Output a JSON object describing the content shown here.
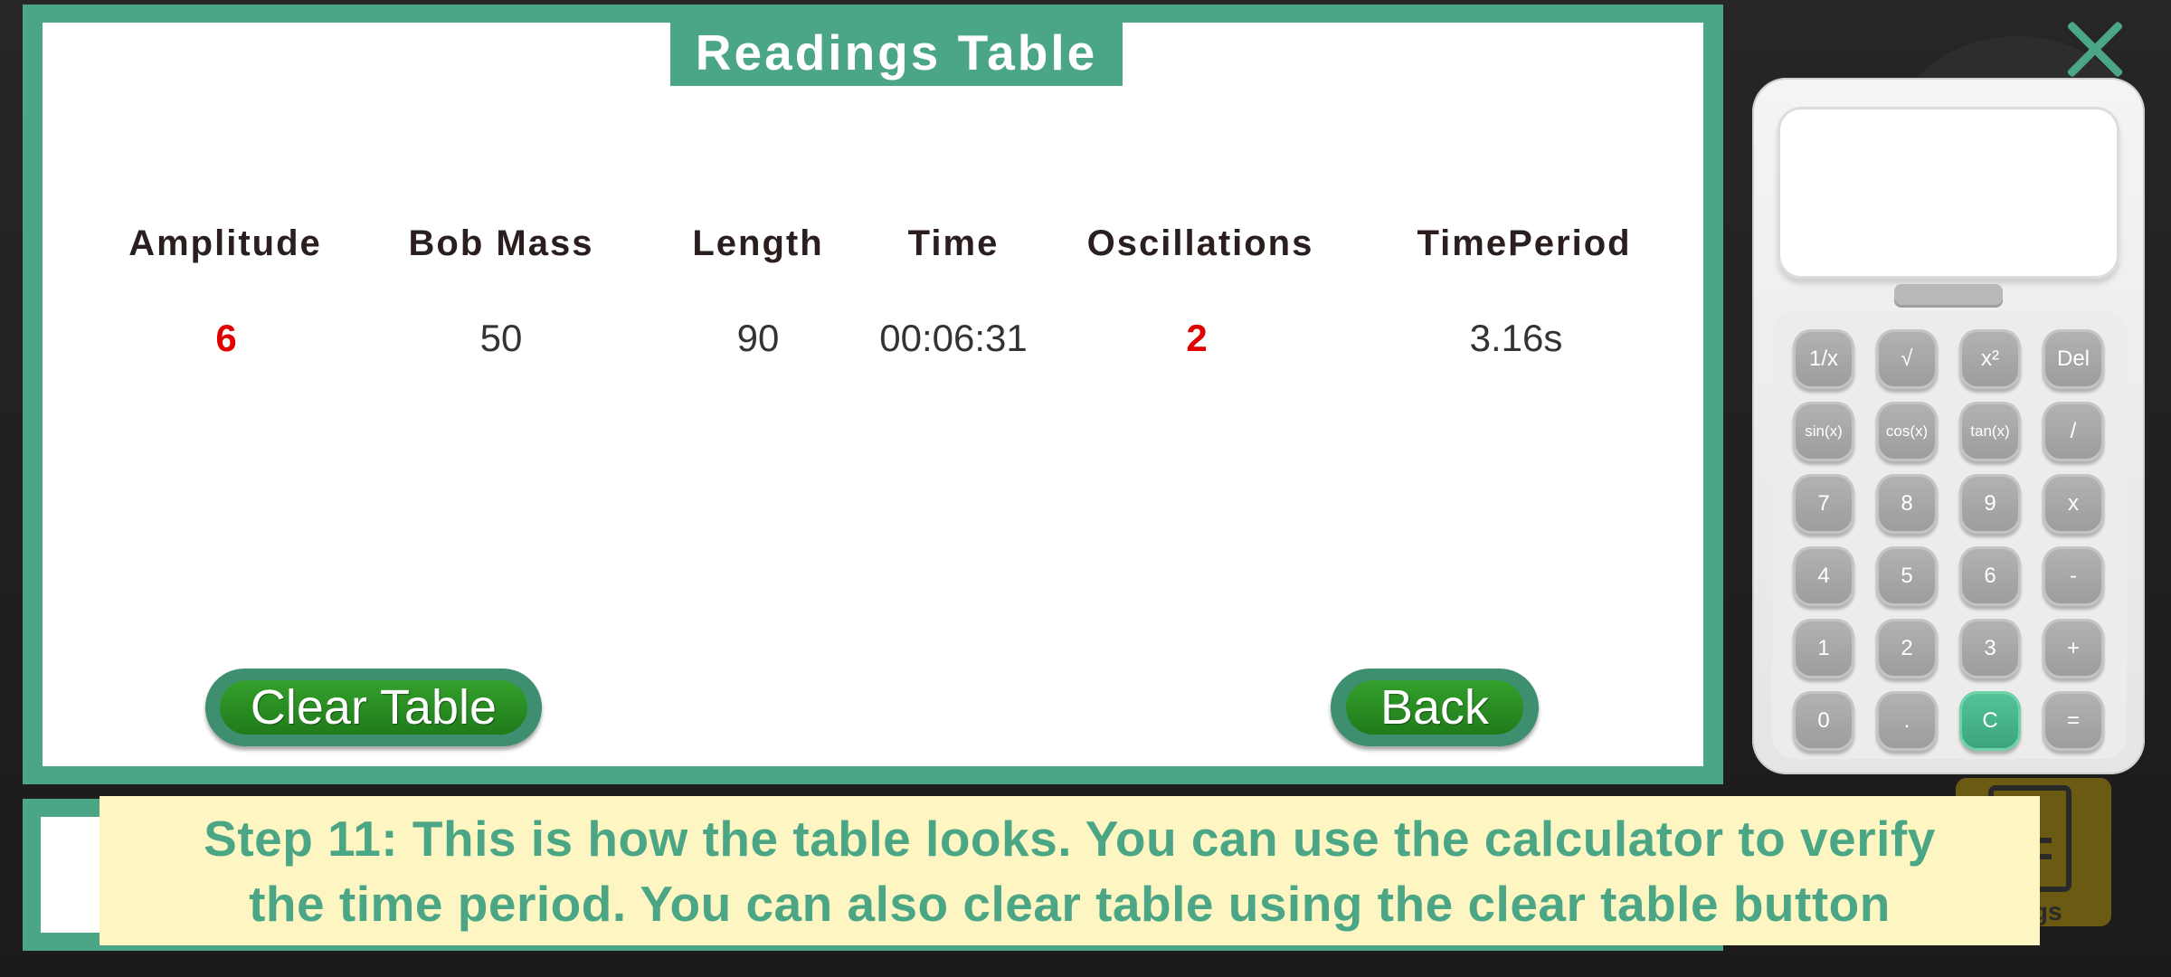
{
  "panel": {
    "title": "Readings Table",
    "columns": [
      "Amplitude",
      "Bob Mass",
      "Length",
      "Time",
      "Oscillations",
      "TimePeriod"
    ],
    "rows": [
      {
        "amplitude": "6",
        "bob_mass": "50",
        "length": "90",
        "time": "00:06:31",
        "oscillations": "2",
        "time_period": "3.16s"
      }
    ],
    "clear_label": "Clear Table",
    "back_label": "Back"
  },
  "calculator": {
    "display": "",
    "keys": [
      [
        "1/x",
        "√",
        "x²",
        "Del"
      ],
      [
        "sin(x)",
        "cos(x)",
        "tan(x)",
        "/"
      ],
      [
        "7",
        "8",
        "9",
        "x"
      ],
      [
        "4",
        "5",
        "6",
        "-"
      ],
      [
        "1",
        "2",
        "3",
        "+"
      ],
      [
        "0",
        ".",
        "C",
        "="
      ]
    ]
  },
  "caption": {
    "line1": "Step 11: This is how the table looks. You can use the calculator to verify",
    "line2": "the time period. You can also clear table using the clear table button"
  },
  "readings_button": {
    "label": "ings"
  },
  "colors": {
    "accent": "#4aa684",
    "highlight": "#e00000",
    "button_green": "#2a8f22",
    "caption_bg": "#fdf5c2"
  },
  "icons": {
    "close": "close-icon",
    "readings": "document-icon"
  }
}
